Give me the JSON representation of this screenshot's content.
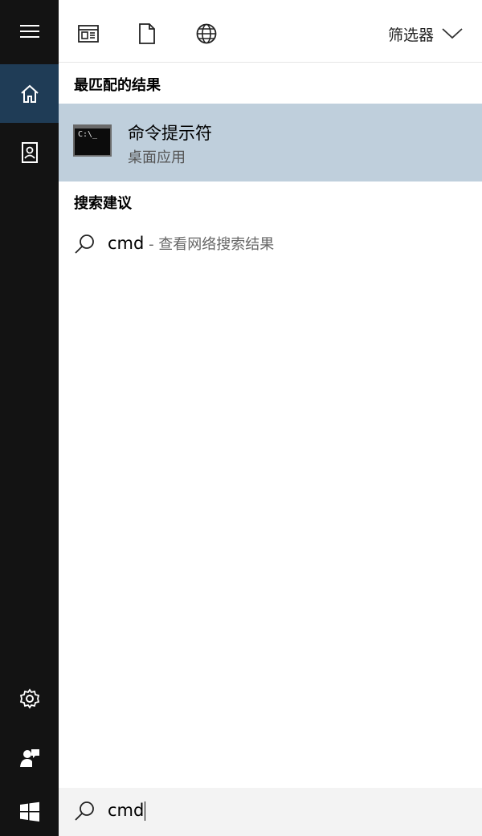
{
  "filter": {
    "label": "筛选器"
  },
  "best_match": {
    "heading": "最匹配的结果",
    "name": "命令提示符",
    "type": "桌面应用",
    "icon_text": "C:\\_"
  },
  "suggestions": {
    "heading": "搜索建议",
    "items": [
      {
        "query": "cmd",
        "suffix": " - 查看网络搜索结果"
      }
    ]
  },
  "search": {
    "value": "cmd"
  },
  "colors": {
    "rail": "#131313",
    "rail_active": "#1f3c56",
    "selected_row": "#bfcfdc",
    "searchbox": "#f3f3f3"
  },
  "icons": [
    "hamburger-icon",
    "home-icon",
    "notebook-icon",
    "settings-icon",
    "user-feedback-icon",
    "windows-logo-icon",
    "apps-icon",
    "document-icon",
    "globe-icon",
    "chevron-down-icon",
    "search-icon"
  ]
}
